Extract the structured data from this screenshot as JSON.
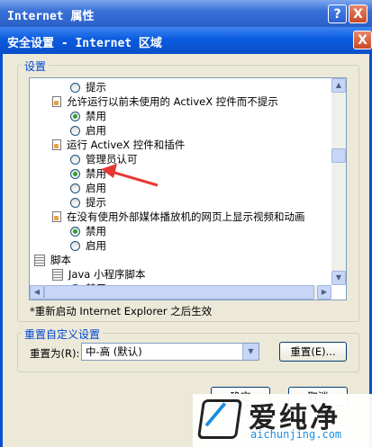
{
  "back_window": {
    "title": "Internet 属性",
    "help_button": "?",
    "close_button": "X",
    "ok_button": "确定"
  },
  "dialog": {
    "title": "安全设置 - Internet 区域",
    "close_button": "X",
    "settings_group_label": "设置",
    "tree_items": [
      {
        "kind": "radio",
        "label": "提示",
        "checked": false
      },
      {
        "kind": "setting",
        "label": "允许运行以前未使用的 ActiveX 控件而不提示"
      },
      {
        "kind": "radio",
        "label": "禁用",
        "checked": true
      },
      {
        "kind": "radio",
        "label": "启用",
        "checked": false
      },
      {
        "kind": "setting",
        "label": "运行 ActiveX 控件和插件"
      },
      {
        "kind": "radio",
        "label": "管理员认可",
        "checked": false
      },
      {
        "kind": "radio",
        "label": "禁用",
        "checked": true
      },
      {
        "kind": "radio",
        "label": "启用",
        "checked": false
      },
      {
        "kind": "radio",
        "label": "提示",
        "checked": false
      },
      {
        "kind": "setting",
        "label": "在没有使用外部媒体播放机的网页上显示视频和动画"
      },
      {
        "kind": "radio",
        "label": "禁用",
        "checked": true
      },
      {
        "kind": "radio",
        "label": "启用",
        "checked": false
      },
      {
        "kind": "category",
        "label": "脚本"
      },
      {
        "kind": "category",
        "label": "Java 小程序脚本"
      },
      {
        "kind": "radio",
        "label": "禁用",
        "checked": false
      }
    ],
    "restart_note": "*重新启动 Internet Explorer 之后生效",
    "reset_group_label": "重置自定义设置",
    "reset_to_label": "重置为(R):",
    "reset_select_value": "中-高 (默认)",
    "reset_button": "重置(E)...",
    "ok_button": "确定",
    "cancel_button": "取消"
  },
  "watermark": {
    "brand": "爱纯净",
    "url": "aichunjing.com"
  },
  "colors": {
    "titlebar": "#0a5be0",
    "dialog_bg": "#ece9d8",
    "group_label": "#0046d5",
    "radio_dot": "#2fa12f",
    "annotation_arrow": "#e53935"
  }
}
